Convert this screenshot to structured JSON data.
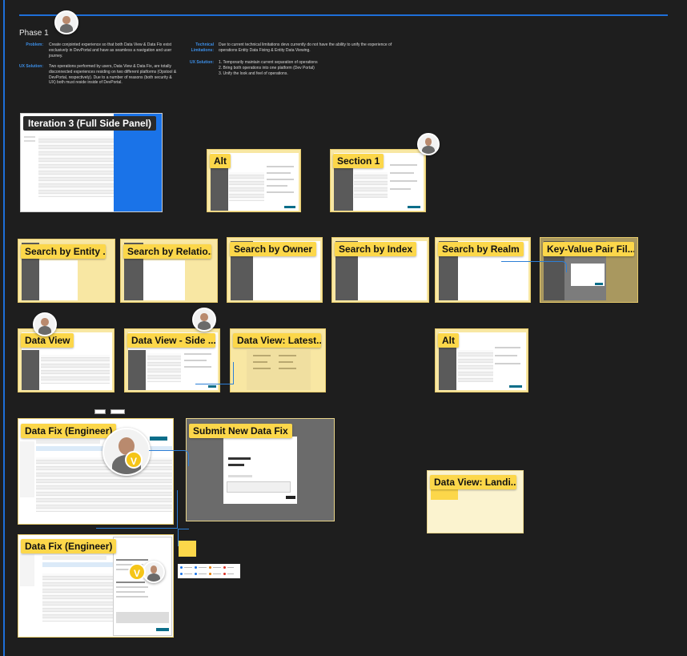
{
  "phase": {
    "title": "Phase 1"
  },
  "problem": {
    "label": "Problem:",
    "text": "Create conjointed experience so that both Data View & Data Fix exist exclusively in DevPortal and have as seamless a navigation and user journey."
  },
  "tech_limitations": {
    "label": "Technical Limitations:",
    "text": "Due to current technical limitations devs currently do not have the ability to unify the experience of operations Entity Data Fixing & Entity Data Viewing."
  },
  "ux_solution_left": {
    "label": "UX Solution:",
    "text": "Two operations performed by users, Data View & Data Fix, are totally disconnected experiences residing on two different platforms (Opstool & DevPortal, respectively). Due to a number of reasons (both security & UX) both must reside inside of DevPortal."
  },
  "ux_solution_right": {
    "label": "UX Solution:",
    "items": [
      "1. Temporarily maintain current separation of operations",
      "2. Bring both operations into one platform (Dev Portal)",
      "3. Unify the look and feel of operations."
    ]
  },
  "frames": {
    "iteration3": "Iteration 3 (Full Side Panel)",
    "alt_top": "Alt",
    "section1": "Section 1",
    "search_entity": "Search by Entity ...",
    "search_relation": "Search by Relatio...",
    "search_owner": "Search by Owner",
    "search_index": "Search by Index",
    "search_realm": "Search by Realm",
    "key_value": "Key-Value Pair Fil...",
    "data_view": "Data View",
    "data_view_side": "Data View - Side ...",
    "data_view_latest": "Data View: Latest...",
    "alt_mid": "Alt",
    "data_fix_1": "Data Fix (Engineer)",
    "submit_fix": "Submit New Data Fix",
    "data_view_landing": "Data View: Landi...",
    "data_fix_2": "Data Fix (Engineer)"
  },
  "presence": {
    "badge_letter": "V"
  },
  "icons": [
    "avatar-icon",
    "v-badge-icon"
  ],
  "colors": {
    "canvas": "#1e1e1e",
    "accent_blue": "#1e6fd9",
    "tag_yellow": "#fcd74a",
    "frame_yellow": "#f8e7a3"
  }
}
